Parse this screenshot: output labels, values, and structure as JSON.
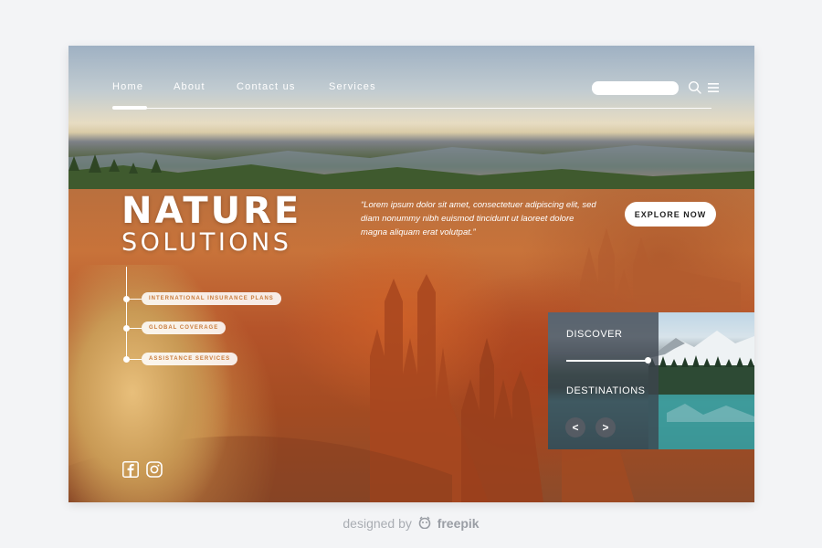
{
  "nav": {
    "links": [
      {
        "label": "Home",
        "active": true
      },
      {
        "label": "About"
      },
      {
        "label": "Contact us"
      },
      {
        "label": "Services"
      }
    ],
    "search": {
      "placeholder": ""
    },
    "icons": {
      "search": "search-icon",
      "menu": "menu-icon"
    }
  },
  "hero": {
    "title_line1": "NATURE",
    "title_line2": "SOLUTIONS",
    "quote": "“Lorem ipsum dolor sit amet, consectetuer adipiscing elit, sed diam nonummy nibh euismod tincidunt ut laoreet dolore magna aliquam erat volutpat.”",
    "cta_label": "EXPLORE NOW"
  },
  "features": [
    {
      "label": "INTERNATIONAL INSURANCE PLANS"
    },
    {
      "label": "GLOBAL COVERAGE"
    },
    {
      "label": "ASSISTANCE SERVICES"
    }
  ],
  "social": [
    {
      "icon": "facebook-icon"
    },
    {
      "icon": "instagram-icon"
    }
  ],
  "panel": {
    "label_top": "DISCOVER",
    "label_bottom": "DESTINATIONS",
    "prev_symbol": "<",
    "next_symbol": ">",
    "slider_level": 1.0
  },
  "credit": {
    "prefix": "designed by",
    "brand": "freepik",
    "icon": "freepik-logo-icon"
  },
  "colors": {
    "accent_text": "#c97b3b",
    "panel_overlay": "#3c444e",
    "page_bg": "#f3f4f6"
  }
}
